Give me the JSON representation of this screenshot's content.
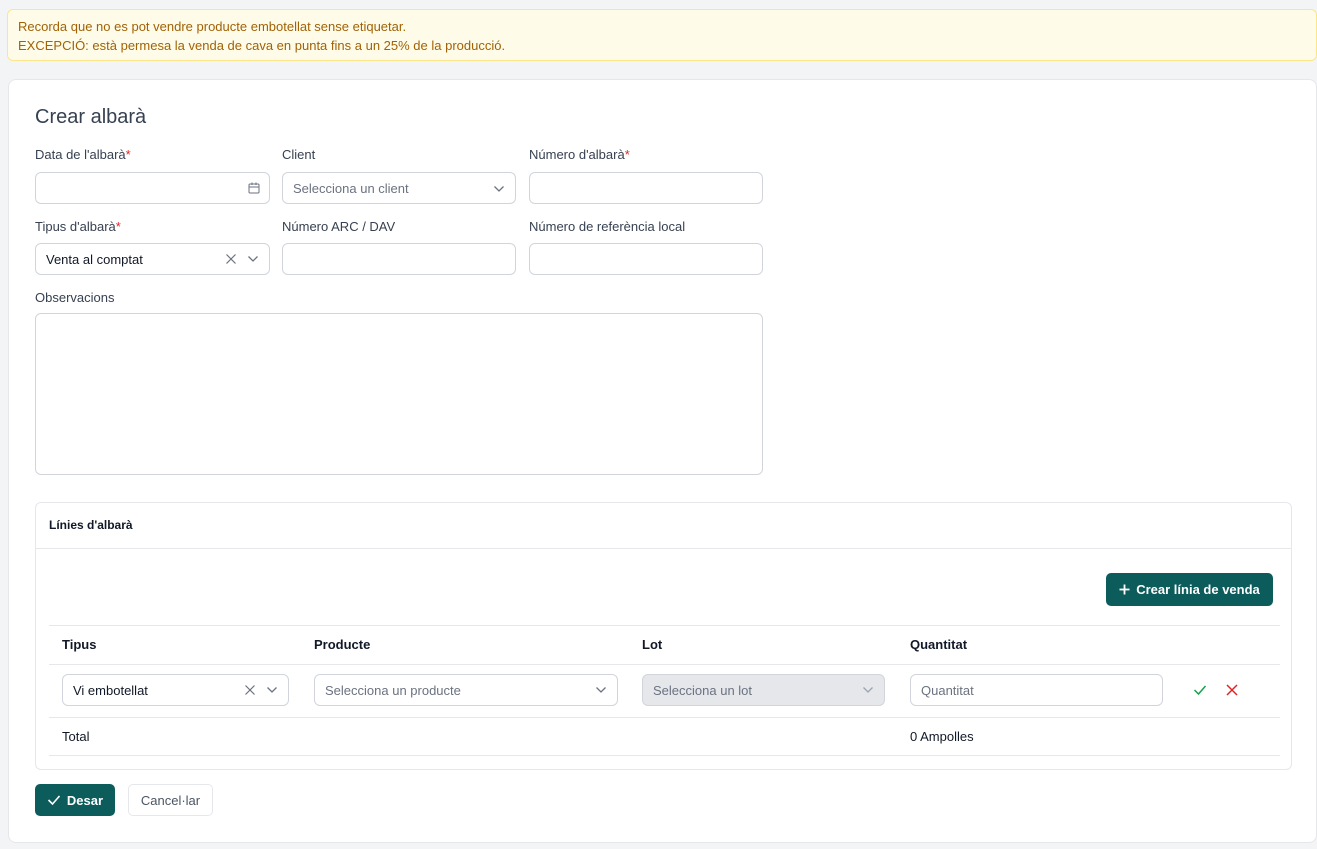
{
  "alert": {
    "line1": "Recorda que no es pot vendre producte embotellat sense etiquetar.",
    "line2": "EXCEPCIÓ: està permesa la venda de cava en punta fins a un 25% de la producció."
  },
  "form": {
    "title": "Crear albarà",
    "date": {
      "label": "Data de l'albarà",
      "required": "*",
      "value": ""
    },
    "client": {
      "label": "Client",
      "placeholder": "Selecciona un client"
    },
    "number": {
      "label": "Número d'albarà",
      "required": "*",
      "value": ""
    },
    "type": {
      "label": "Tipus d'albarà",
      "required": "*",
      "value": "Venta al comptat"
    },
    "arc": {
      "label": "Número ARC / DAV",
      "value": ""
    },
    "ref": {
      "label": "Número de referència local",
      "value": ""
    },
    "notes": {
      "label": "Observacions",
      "value": ""
    }
  },
  "lines": {
    "title": "Línies d'albarà",
    "create_button": "Crear línia de venda",
    "columns": [
      "Tipus",
      "Producte",
      "Lot",
      "Quantitat"
    ],
    "row": {
      "type": "Vi embotellat",
      "product_placeholder": "Selecciona un producte",
      "lot_placeholder": "Selecciona un lot",
      "quantity_placeholder": "Quantitat"
    },
    "total_label": "Total",
    "total_value": "0 Ampolles"
  },
  "actions": {
    "save": "Desar",
    "cancel": "Cancel·lar"
  },
  "colors": {
    "primary": "#0d5c5c",
    "alert_bg": "#fefce8",
    "alert_text": "#a16207",
    "required": "#dc2626",
    "confirm": "#16a34a",
    "delete": "#dc2626"
  }
}
